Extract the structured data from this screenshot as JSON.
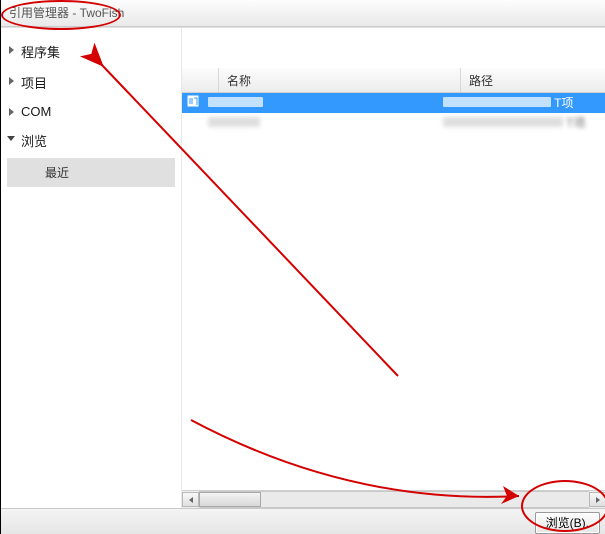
{
  "window": {
    "title": "引用管理器 - TwoFish"
  },
  "sidebar": {
    "items": [
      {
        "label": "程序集",
        "expandable": true,
        "expanded": false
      },
      {
        "label": "项目",
        "expandable": true,
        "expanded": false
      },
      {
        "label": "COM",
        "expandable": true,
        "expanded": false
      },
      {
        "label": "浏览",
        "expandable": true,
        "expanded": true
      }
    ],
    "sub": {
      "label": "最近"
    }
  },
  "list": {
    "columns": {
      "name": "名称",
      "path": "路径"
    },
    "rows": [
      {
        "selected": true,
        "checked": true,
        "name": "",
        "path": "",
        "path_suffix": "T项"
      },
      {
        "selected": false,
        "checked": false,
        "name": "",
        "path": "",
        "path_suffix": "T项"
      }
    ]
  },
  "footer": {
    "browse_label": "浏览(B)."
  }
}
